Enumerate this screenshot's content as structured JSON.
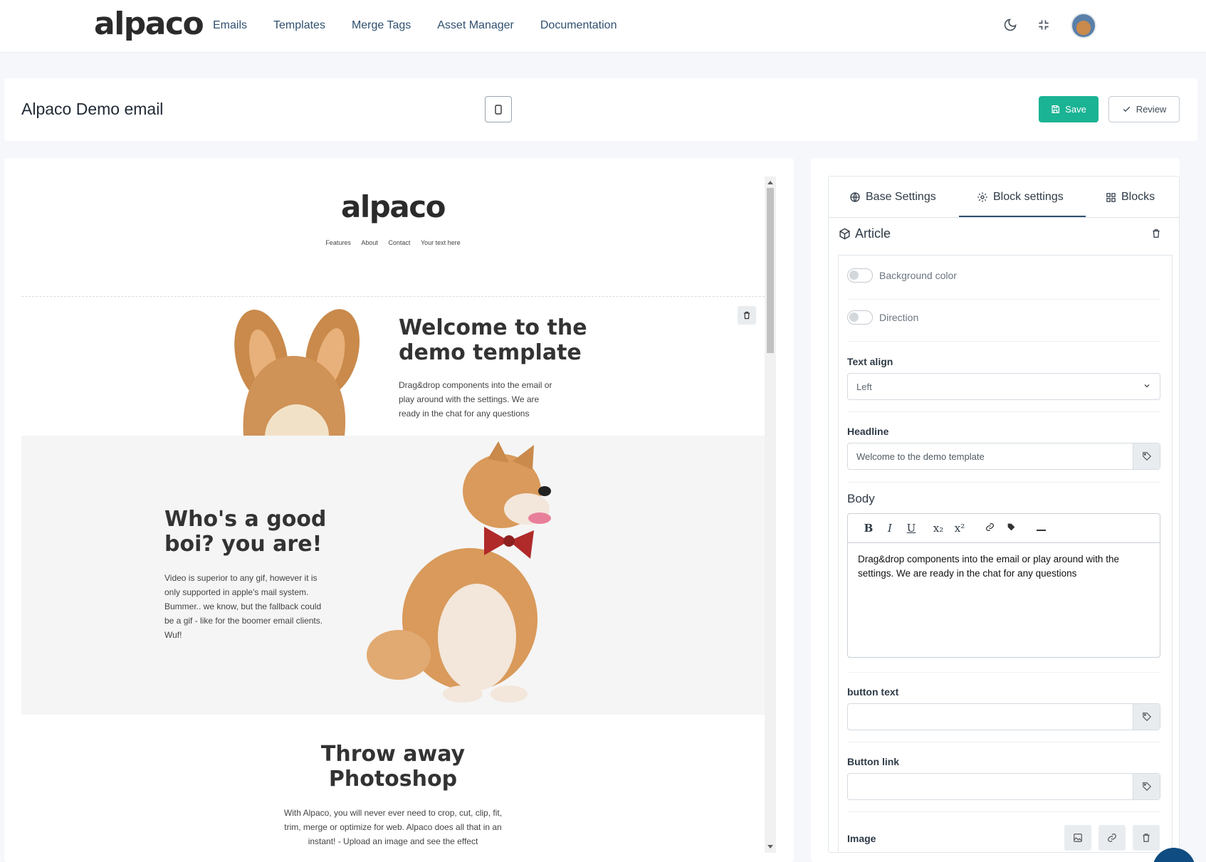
{
  "nav": {
    "logo": "alpaco",
    "links": [
      "Emails",
      "Templates",
      "Merge Tags",
      "Asset Manager",
      "Documentation"
    ]
  },
  "header": {
    "title": "Alpaco Demo email",
    "save_label": "Save",
    "review_label": "Review"
  },
  "preview": {
    "logo": "alpaco",
    "menu": [
      "Features",
      "About",
      "Contact",
      "Your text here"
    ],
    "welcome_title": "Welcome to the demo template",
    "welcome_body": "Drag&drop components into the email or play around with the settings. We are ready in the chat for any questions",
    "boi_title": "Who's a good boi? you are!",
    "boi_body": "Video is superior to any gif, however it is only supported in apple's mail system. Bummer.. we know, but the fallback could be a gif - like for the boomer email clients. Wuf!",
    "photoshop_title": "Throw away Photoshop",
    "photoshop_body": "With Alpaco, you will never ever need to crop, cut, clip, fit, trim, merge or optimize for web. Alpaco does all that in an instant! - Upload an image and see the effect"
  },
  "settings": {
    "tabs": [
      "Base Settings",
      "Block settings",
      "Blocks"
    ],
    "active_tab": "Block settings",
    "block_name": "Article",
    "toggles": [
      "Background color",
      "Direction"
    ],
    "text_align_label": "Text align",
    "text_align_value": "Left",
    "headline_label": "Headline",
    "headline_value": "Welcome to the demo template",
    "body_label": "Body",
    "body_value": "Drag&drop components into the email or play around with the settings. We are ready in the chat for any questions",
    "button_text_label": "button text",
    "button_text_value": "",
    "button_link_label": "Button link",
    "button_link_value": "",
    "image_label": "Image"
  },
  "colors": {
    "accent": "#1ab394",
    "nav_text": "#2f4f6f",
    "grey_block": "#f5f5f5"
  }
}
